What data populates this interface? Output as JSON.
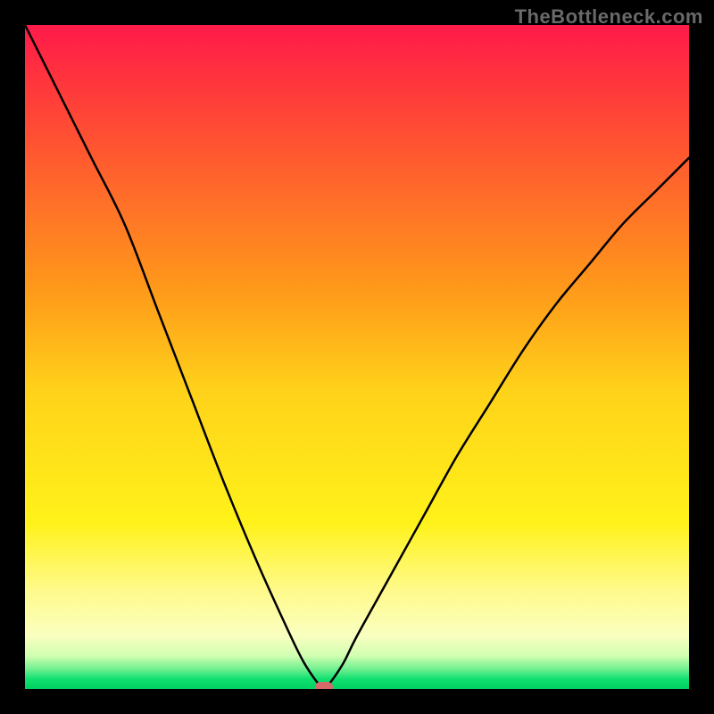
{
  "watermark": "TheBottleneck.com",
  "chart_data": {
    "type": "line",
    "title": "",
    "xlabel": "",
    "ylabel": "",
    "xlim": [
      0,
      100
    ],
    "ylim": [
      0,
      100
    ],
    "x": [
      0,
      5,
      10,
      15,
      20,
      25,
      30,
      35,
      40,
      42,
      44,
      45,
      46,
      48,
      50,
      55,
      60,
      65,
      70,
      75,
      80,
      85,
      90,
      95,
      100
    ],
    "values": [
      100,
      90,
      80,
      70,
      57,
      44,
      31,
      19,
      8,
      4,
      1,
      0,
      1,
      4,
      8,
      17,
      26,
      35,
      43,
      51,
      58,
      64,
      70,
      75,
      80
    ],
    "marker": {
      "x": 45,
      "y": 0
    },
    "gradient_stops": [
      {
        "pos": 0,
        "color": "#ff1a4a"
      },
      {
        "pos": 55,
        "color": "#ffd21a"
      },
      {
        "pos": 100,
        "color": "#00d060"
      }
    ]
  }
}
